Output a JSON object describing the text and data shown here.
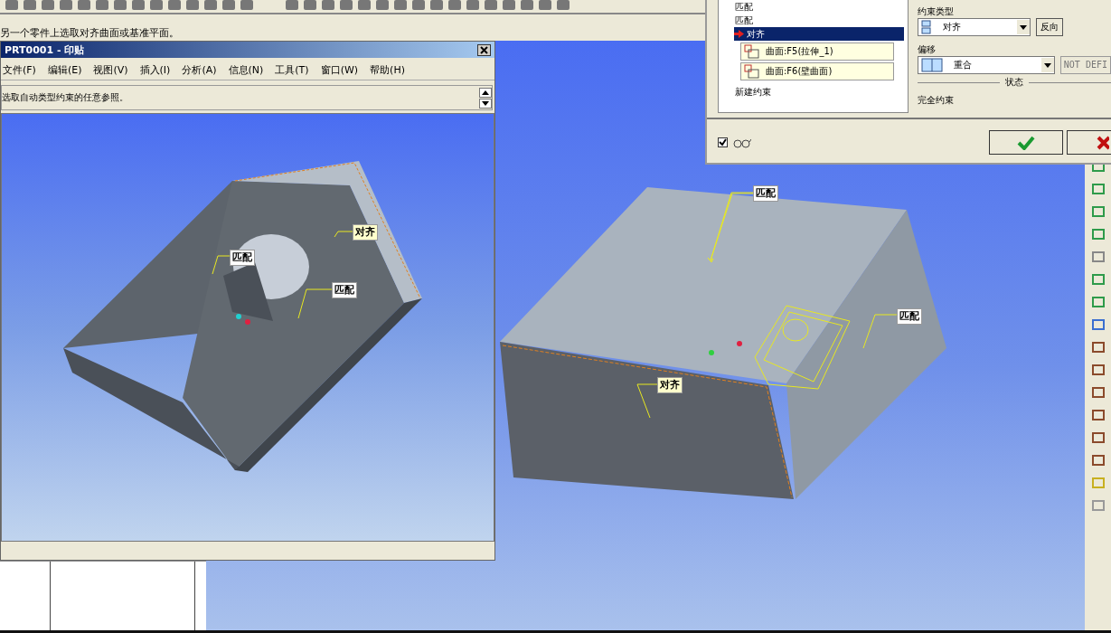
{
  "message": "另一个零件上选取对齐曲面或基准平面。",
  "part_window": {
    "title": "PRT0001 - 印贴",
    "menu": [
      "文件(F)",
      "编辑(E)",
      "视图(V)",
      "插入(I)",
      "分析(A)",
      "信息(N)",
      "工具(T)",
      "窗口(W)",
      "帮助(H)"
    ],
    "prompt": "选取自动类型约束的任意参照。",
    "annotations": [
      {
        "text": "匹配"
      },
      {
        "text": "对齐"
      },
      {
        "text": "匹配"
      }
    ]
  },
  "assembly_annotations": [
    {
      "text": "匹配"
    },
    {
      "text": "匹配"
    },
    {
      "text": "对齐"
    }
  ],
  "dialog": {
    "constraints": [
      {
        "label": "匹配",
        "selected": false
      },
      {
        "label": "匹配",
        "selected": false
      },
      {
        "label": "对齐",
        "selected": true
      }
    ],
    "references": [
      "曲面:F5(拉伸_1)",
      "曲面:F6(壁曲面)"
    ],
    "new_constraint": "新建约束",
    "constraint_type_label": "约束类型",
    "constraint_type": "对齐",
    "flip_button": "反向",
    "offset_label": "偏移",
    "offset": "重合",
    "offset_value": "NOT DEFI",
    "status_label": "状态",
    "status": "完全约束",
    "preview": {
      "checked": true
    }
  }
}
